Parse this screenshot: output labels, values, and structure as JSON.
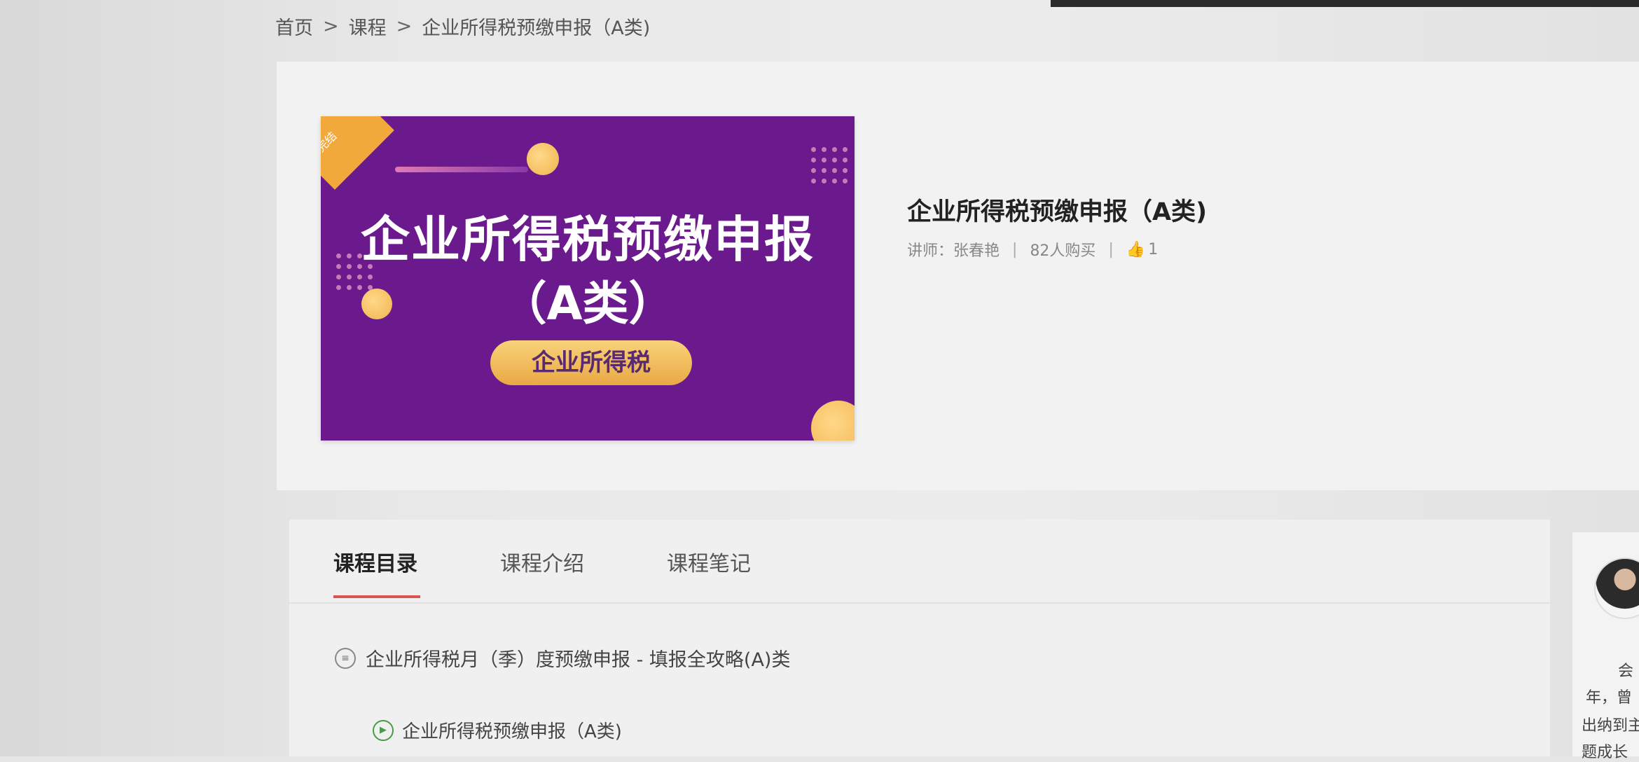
{
  "breadcrumb": {
    "home": "首页",
    "sep1": ">",
    "courses": "课程",
    "sep2": ">",
    "current": "企业所得税预缴申报（A类)"
  },
  "cover": {
    "corner_label": "已完结",
    "title": "企业所得税预缴申报",
    "subtitle": "（A类）",
    "pill": "企业所得税",
    "colors": {
      "background": "#6a1a8c",
      "accent": "#f2a93b",
      "pill": "#f2c062"
    }
  },
  "course": {
    "title": "企业所得税预缴申报（A类)",
    "lecturer": "讲师：张春艳",
    "sep1": "|",
    "buyers": "82人购买",
    "sep2": "|",
    "likes": "1",
    "like_icon": "thumbs-up-icon"
  },
  "tabs": [
    {
      "label": "课程目录",
      "active": true
    },
    {
      "label": "课程介绍",
      "active": false
    },
    {
      "label": "课程笔记",
      "active": false
    }
  ],
  "catalog": {
    "chapter": {
      "icon": "list-icon",
      "label": "企业所得税月（季）度预缴申报 - 填报全攻略(A)类"
    },
    "lessons": [
      {
        "icon": "play-icon",
        "label": "企业所得税预缴申报（A类)"
      }
    ]
  },
  "side": {
    "avatar": "lecturer-avatar",
    "lines": [
      "会",
      "年，曾",
      "出纳到主",
      "题成长"
    ]
  }
}
